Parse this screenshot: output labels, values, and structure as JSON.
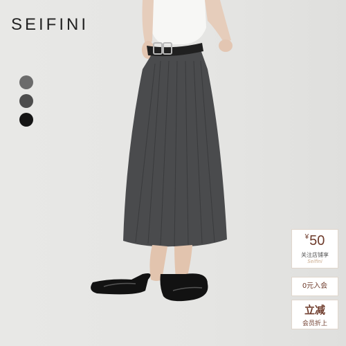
{
  "brand": {
    "name": "SEIFINI"
  },
  "colors": {
    "background": "#e4e4e2",
    "skirt": "#4a4b4d",
    "accent": "#6e3b2b"
  },
  "swatches": [
    {
      "name": "grey",
      "color": "#6b6b6b"
    },
    {
      "name": "dark-grey",
      "color": "#4d4d4d"
    },
    {
      "name": "black",
      "color": "#151515"
    }
  ],
  "coupon": {
    "currency": "¥",
    "amount": "50",
    "note": "关注店铺享",
    "signature": "Seifini"
  },
  "benefits": {
    "join_label": "0元入会",
    "instant_discount": "立减",
    "member_discount": "会员折上"
  }
}
